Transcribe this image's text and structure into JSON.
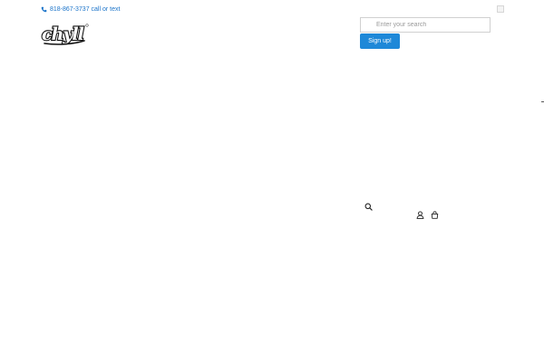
{
  "topbar": {
    "phone_text": "818-867-3737 call or text",
    "phone_icon": "phone-icon",
    "close_icon": "close-box-icon"
  },
  "header": {
    "logo_text": "chyll",
    "logo_mark": "chyll-logo"
  },
  "search": {
    "placeholder": "Enter your search",
    "value": ""
  },
  "signup": {
    "label": "Sign up!"
  },
  "toolbar": {
    "icons": [
      "search-icon",
      "user-icon",
      "cart-icon"
    ]
  },
  "colors": {
    "link": "#1a73c9",
    "button": "#1e88d8",
    "button_text": "#ffffff",
    "input_border": "#d0d0d0"
  }
}
